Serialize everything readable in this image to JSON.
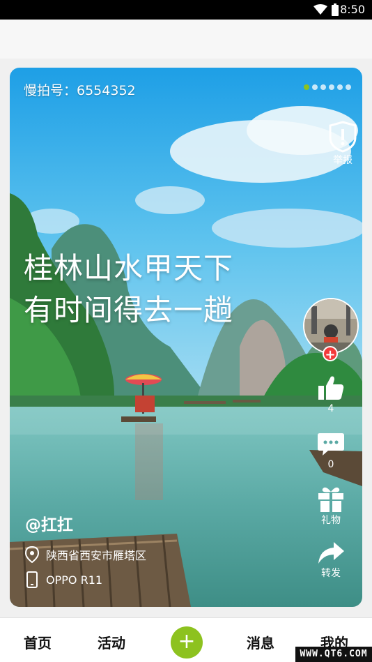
{
  "status_bar": {
    "time": "8:50",
    "icons": [
      "wifi-icon",
      "battery-icon"
    ]
  },
  "post": {
    "id_label": "慢拍号：6554352",
    "pager": {
      "count": 6,
      "active_index": 0,
      "active_color": "#8dc21f"
    },
    "caption_line1": "桂林山水甲天下",
    "caption_line2": "有时间得去一趟",
    "author": "@扛扛",
    "location": "陕西省西安市雁塔区",
    "device": "OPPO R11"
  },
  "actions": {
    "report_label": "举报",
    "like_count": "4",
    "comment_count": "0",
    "gift_label": "礼物",
    "share_label": "转发"
  },
  "tabbar": {
    "home": "首页",
    "activity": "活动",
    "add": "+",
    "messages": "消息",
    "mine": "我的",
    "accent": "#8dc21f"
  },
  "watermark": "WWW.QT6.COM"
}
